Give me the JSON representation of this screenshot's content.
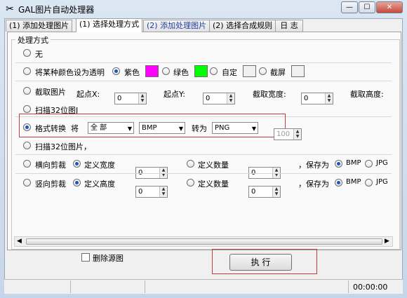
{
  "window": {
    "title": "GAL图片自动处理器",
    "min_label": "—",
    "max_label": "☐",
    "close_label": "✕",
    "icon": "scissors-icon"
  },
  "tabs": [
    {
      "label": "(1) 添加处理图片"
    },
    {
      "label": "(1) 选择处理方式"
    },
    {
      "label": "(2) 添加处理图片"
    },
    {
      "label": "(2) 选择合成规则"
    },
    {
      "label": "日 志"
    }
  ],
  "group_label": "处理方式",
  "options": {
    "none": "无",
    "transparent": "将某种颜色设为透明",
    "purple": "紫色",
    "green": "绿色",
    "custom": "自定",
    "screen": "截屏",
    "crop": "截取图片",
    "start_x": "起点X:",
    "start_y": "起点Y:",
    "crop_width": "截取宽度:",
    "crop_height": "截取高度:",
    "scan32": "扫描32位图J",
    "format_convert": "格式转换",
    "jiang": "将",
    "scope_value": "全 部",
    "from_format": "BMP",
    "to_label": "转为",
    "to_format": "PNG",
    "quality_value": "100",
    "scan32_b": "扫描32位图片，",
    "hcut": "横向剪裁",
    "def_width": "定义宽度",
    "def_count": "定义数量",
    "save_as": "，保存为",
    "bmp": "BMP",
    "jpg": "JPG",
    "vcut": "竖向剪裁",
    "def_height": "定义高度",
    "zero": "0"
  },
  "colors": {
    "purple": "#ff00ff",
    "green": "#00ff00",
    "custom": "#f0f0f0",
    "screen": "#f0f0f0"
  },
  "delete_source": "删除源图",
  "execute_label": "执 行",
  "status": {
    "time": "00:00:00"
  }
}
